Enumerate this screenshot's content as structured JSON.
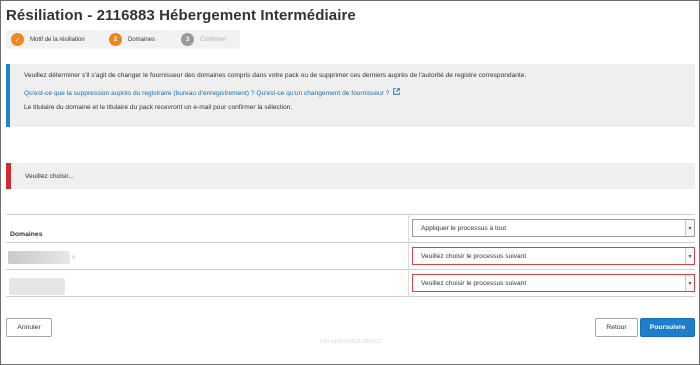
{
  "page": {
    "title": "Résiliation - 2116883 Hébergement Intermédiaire"
  },
  "stepper": {
    "steps": [
      {
        "number": "✓",
        "label": "Motif de la résiliation",
        "state": "done"
      },
      {
        "number": "2",
        "label": "Domaines",
        "state": "active"
      },
      {
        "number": "3",
        "label": "Confirmer",
        "state": "pending"
      }
    ]
  },
  "info": {
    "line1": "Veuillez déterminer s'il s'agit de changer le fournisseur des domaines compris dans votre pack ou de supprimer ces derniers auprès de l'autorité de registre correspondante.",
    "link1": "Qu'est-ce que la suppression auprès du registraire (bureau d'enregistrement) ?",
    "link2": "Qu'est-ce qu'un changement de fournisseur ?",
    "line3": "Le titulaire du domaine et le titulaire du pack recevront un e-mail pour confirmer la sélection.",
    "accent_color": "#1b88c7",
    "link_icon": "external-link-icon"
  },
  "warning": {
    "text": "Veuillez choisir...",
    "accent_color": "#d22b2b"
  },
  "table": {
    "header_label": "Domaines",
    "apply_all_value": "Appliquer le processus à tout",
    "rows": [
      {
        "select_value": "Veuillez choisir le processus suivant",
        "domain_tail": "o"
      },
      {
        "select_value": "Veuillez choisir le processus suivant"
      }
    ]
  },
  "buttons": {
    "cancel": "Annuler",
    "back": "Retour",
    "continue": "Poursuivre",
    "primary_color": "#1d7fcc"
  },
  "footer": {
    "info_id": "Info cdx53959161960412"
  }
}
